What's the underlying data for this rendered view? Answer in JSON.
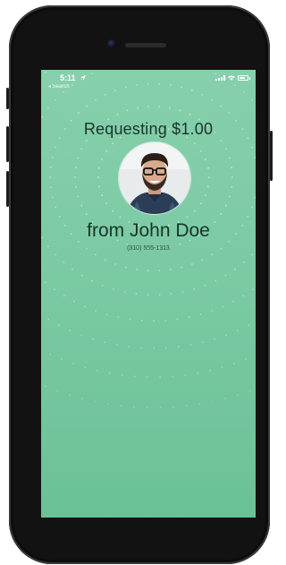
{
  "statusbar": {
    "time": "5:11",
    "back_label": "◂ Search"
  },
  "request": {
    "title": "Requesting $1.00",
    "from": "from John Doe",
    "phone": "(310) 555-1313"
  },
  "icons": {
    "signal": "signal-icon",
    "wifi": "wifi-icon",
    "battery": "battery-icon",
    "location": "location-arrow-icon"
  },
  "colors": {
    "screen_top": "#86d0ac",
    "screen_bottom": "#6bc196",
    "text": "#18352a"
  }
}
